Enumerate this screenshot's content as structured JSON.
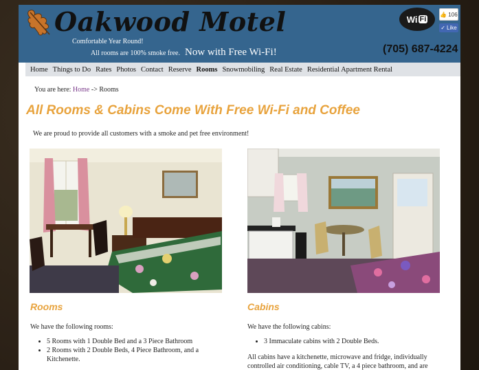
{
  "header": {
    "logo_text": "Oakwood Motel",
    "tagline": "Comfortable Year Round!",
    "smoke_free": "All rooms are 100% smoke free.",
    "wifi_note": "Now with Free Wi-Fi!",
    "phone": "(705) 687-4224",
    "wifi_badge": {
      "wi": "Wi",
      "fi": "Fi"
    },
    "like_count": "106",
    "like_label": "Like"
  },
  "nav": {
    "items": [
      {
        "label": "Home"
      },
      {
        "label": "Things to Do"
      },
      {
        "label": "Rates"
      },
      {
        "label": "Photos"
      },
      {
        "label": "Contact"
      },
      {
        "label": "Reserve"
      },
      {
        "label": "Rooms",
        "active": true
      },
      {
        "label": "Snowmobiling"
      },
      {
        "label": "Real Estate"
      },
      {
        "label": "Residential Apartment Rental"
      }
    ]
  },
  "breadcrumb": {
    "prefix": "You are here:",
    "home": "Home",
    "separator": "->",
    "current": "Rooms"
  },
  "main": {
    "title": "All Rooms & Cabins Come With Free Wi-Fi and Coffee",
    "intro": "We are proud to provide all customers with a smoke and pet free environment!"
  },
  "rooms": {
    "title": "Rooms",
    "lead": "We have the following rooms:",
    "items": [
      "5 Rooms with 1 Double Bed and a 3 Piece Bathroom",
      "2 Rooms with 2 Double Beds, 4 Piece Bathroom, and a Kitchenette."
    ]
  },
  "cabins": {
    "title": "Cabins",
    "lead": "We have the following cabins:",
    "items": [
      "3 Immaculate cabins with 2 Double Beds."
    ],
    "description": "All cabins have a kitchenette, microwave and fridge, individually controlled air conditioning, cable TV, a 4 piece bathroom, and are"
  },
  "colors": {
    "header_bg": "#35658e",
    "accent": "#e8a33d",
    "nav_bg": "#dfe2e6",
    "link": "#7a3a8a"
  }
}
